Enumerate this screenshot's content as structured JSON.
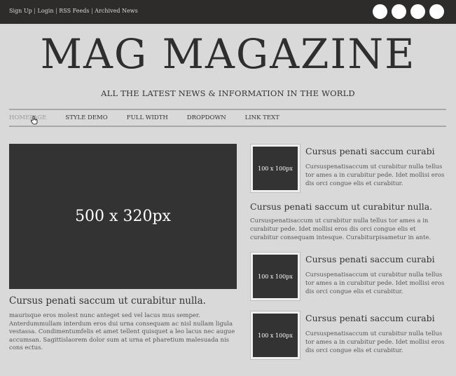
{
  "top_links": {
    "signup": "Sign Up",
    "login": "Login",
    "rss": "RSS Feeds",
    "archived": "Archived News",
    "separator": "|"
  },
  "social_icons": [
    "social-icon-1",
    "social-icon-2",
    "social-icon-3",
    "social-icon-4"
  ],
  "site": {
    "logo": "MAG MAGAZINE",
    "tagline": "ALL THE LATEST NEWS & INFORMATION IN THE WORLD"
  },
  "nav": [
    "HOMEPAGE",
    "STYLE DEMO",
    "FULL WIDTH",
    "DROPDOWN",
    "LINK TEXT"
  ],
  "hero": {
    "image_label": "500 x 320px",
    "title": "Cursus penati saccum ut curabitur nulla.",
    "text": "maurisque eros molest nunc anteget sed vel lacus mus semper. Anterdummullam interdum eros dui urna consequam ac nisl nullam ligula vestassa. Condimentumfelis et amet tellent quisquet a leo lacus nec augue accumsan. Sagittislaorem dolor sum at urna et pharetium malesuada nis cons ectus."
  },
  "side": {
    "thumb_label": "100 x 100px",
    "items": [
      {
        "title": "Cursus penati saccum curabi",
        "text": "Cursuspenatisaccum ut curabitur nulla tellus tor ames a in curabitur pede. Idet mollisi eros dis orci congue elis et curabitur."
      },
      {
        "title": "Cursus penati saccum ut curabitur nulla.",
        "text": "Cursuspenatisaccum ut curabitur nulla tellus tor ames a in curabitur pede. Idet mollisi eros dis orci congue elis et curabitur consequam intesque. Curabiturpisametur in ante."
      },
      {
        "title": "Cursus penati saccum curabi",
        "text": "Cursuspenatisaccum ut curabitur nulla tellus tor ames a in curabitur pede. Idet mollisi eros dis orci congue elis et curabitur."
      },
      {
        "title": "Cursus penati saccum curabi",
        "text": "Cursuspenatisaccum ut curabitur nulla tellus tor ames a in curabitur pede. Idet mollisi eros dis orci congue elis et curabitur."
      }
    ]
  }
}
